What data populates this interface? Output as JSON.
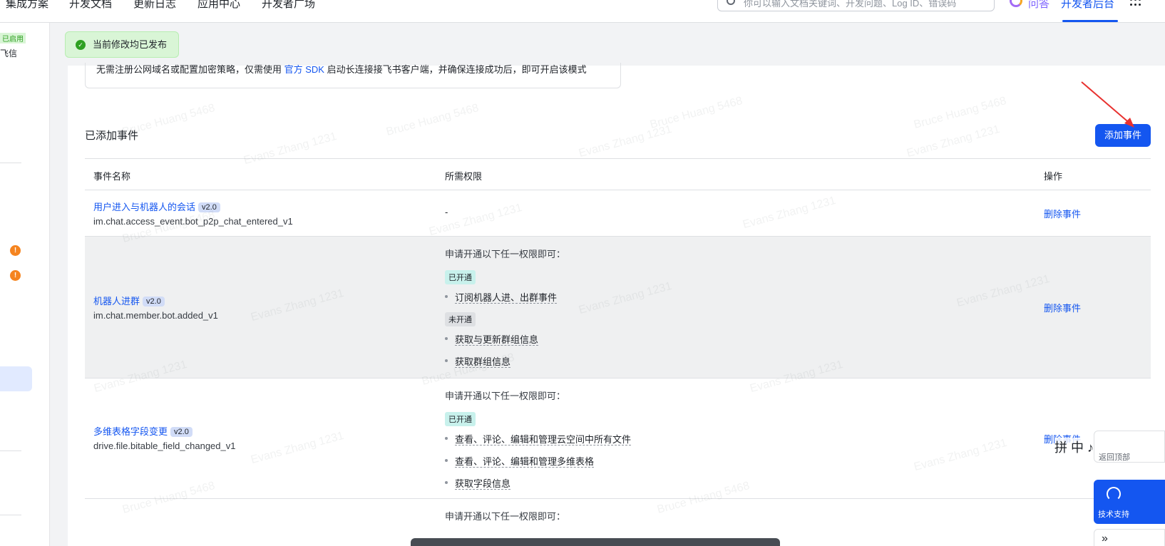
{
  "topnav": {
    "items": [
      "集成方案",
      "开发文档",
      "更新日志",
      "应用中心",
      "开发者广场"
    ],
    "search_placeholder": "你可以输入文档关键词、开发问题、Log ID、错误码",
    "ai_label": "问答",
    "console_label": "开发者后台"
  },
  "sidebar": {
    "enabled_badge": "已启用",
    "app_name": "飞信",
    "warn_mark": "!"
  },
  "toast": {
    "icon": "check-circle-icon",
    "text": "当前修改均已发布"
  },
  "notice": {
    "text_before": "无需注册公网域名或配置加密策略，仅需使用 ",
    "link": "官方 SDK",
    "text_after": " 启动长连接接飞书客户端，并确保连接成功后，即可开启该模式"
  },
  "events": {
    "section_title": "已添加事件",
    "add_button": "添加事件",
    "columns": {
      "name": "事件名称",
      "permission": "所需权限",
      "action": "操作"
    },
    "apply_any": "申请开通以下任一权限即可：",
    "status_on": "已开通",
    "status_off": "未开通",
    "delete_label": "删除事件",
    "rows": [
      {
        "name": "用户进入与机器人的会话",
        "version": "v2.0",
        "key": "im.chat.access_event.bot_p2p_chat_entered_v1",
        "permission_none": "-"
      },
      {
        "name": "机器人进群",
        "version": "v2.0",
        "key": "im.chat.member.bot.added_v1",
        "perms_on": [
          "订阅机器人进、出群事件"
        ],
        "perms_off": [
          "获取与更新群组信息",
          "获取群组信息"
        ]
      },
      {
        "name": "多维表格字段变更",
        "version": "v2.0",
        "key": "drive.file.bitable_field_changed_v1",
        "perms_on": [
          "查看、评论、编辑和管理云空间中所有文件",
          "查看、评论、编辑和管理多维表格",
          "获取字段信息"
        ]
      }
    ]
  },
  "watermarks": [
    "Bruce Huang 5468",
    "Evans Zhang 1231"
  ],
  "float_tools": {
    "ime_text": "拼 中 ♪",
    "back_top": "返回顶部",
    "support": "技术支持",
    "expand": "»"
  },
  "colors": {
    "primary": "#1456f0",
    "success": "#2ea121",
    "warn": "#f5841f"
  }
}
